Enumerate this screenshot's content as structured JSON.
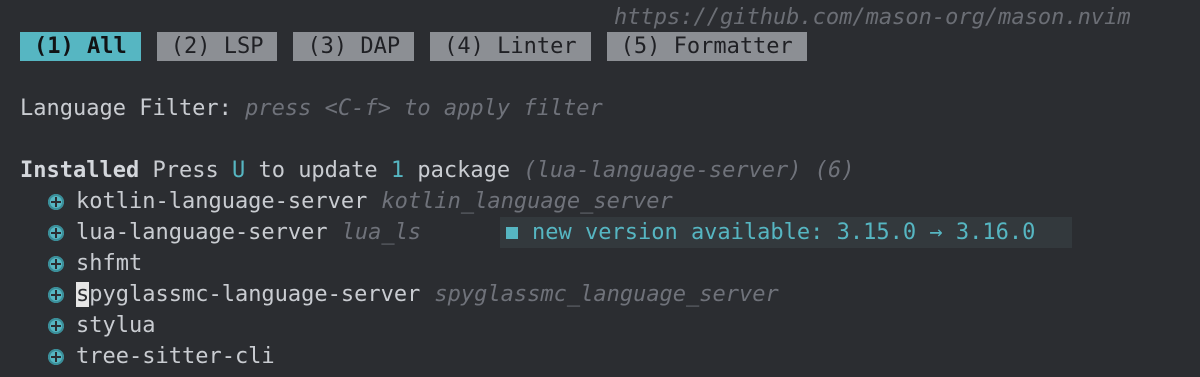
{
  "header": {
    "url": "https://github.com/mason-org/mason.nvim"
  },
  "tabs": [
    {
      "label": "(1) All",
      "active": true
    },
    {
      "label": "(2) LSP",
      "active": false
    },
    {
      "label": "(3) DAP",
      "active": false
    },
    {
      "label": "(4) Linter",
      "active": false
    },
    {
      "label": "(5) Formatter",
      "active": false
    }
  ],
  "filter": {
    "label": "Language Filter:",
    "hint": "press <C-f> to apply filter"
  },
  "installed": {
    "heading": "Installed",
    "press": "Press",
    "key": "U",
    "to_update": "to update",
    "count": "1",
    "package_word": "package",
    "pending": "(lua-language-server)",
    "total": "(6)"
  },
  "packages": [
    {
      "name": "kotlin-language-server",
      "alias": "kotlin_language_server"
    },
    {
      "name": "lua-language-server",
      "alias": "lua_ls"
    },
    {
      "name": "shfmt",
      "alias": ""
    },
    {
      "name": "spyglassmc-language-server",
      "alias": "spyglassmc_language_server"
    },
    {
      "name": "stylua",
      "alias": ""
    },
    {
      "name": "tree-sitter-cli",
      "alias": ""
    }
  ],
  "update_notice": {
    "text": "new version available: 3.15.0 → 3.16.0"
  },
  "cursor_char": "s",
  "colors": {
    "accent": "#56b6c2",
    "background": "#2b2d31",
    "tab_inactive": "#8c8f94"
  }
}
